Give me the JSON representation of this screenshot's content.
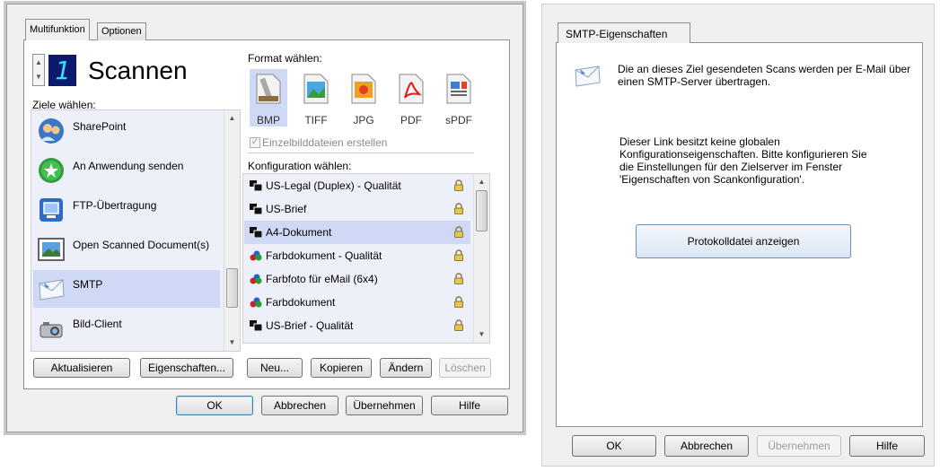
{
  "left_dialog": {
    "tabs": [
      "Multifunktion",
      "Optionen"
    ],
    "mode_number": "1",
    "mode_title": "Scannen",
    "destinations_label": "Ziele wählen:",
    "destinations": [
      {
        "label": "SharePoint",
        "icon": "sharepoint-icon",
        "selected": false
      },
      {
        "label": "An Anwendung senden",
        "icon": "send-to-application-icon",
        "selected": false
      },
      {
        "label": "FTP-Übertragung",
        "icon": "ftp-transfer-icon",
        "selected": false
      },
      {
        "label": "Open Scanned Document(s)",
        "icon": "open-document-icon",
        "selected": false
      },
      {
        "label": "SMTP",
        "icon": "smtp-envelope-icon",
        "selected": true
      },
      {
        "label": "Bild-Client",
        "icon": "image-client-icon",
        "selected": false
      }
    ],
    "format_label": "Format wählen:",
    "formats": [
      {
        "label": "BMP",
        "selected": true
      },
      {
        "label": "TIFF",
        "selected": false
      },
      {
        "label": "JPG",
        "selected": false
      },
      {
        "label": "PDF",
        "selected": false
      },
      {
        "label": "sPDF",
        "selected": false
      }
    ],
    "single_files_checkbox": {
      "label": "Einzelbilddateien erstellen",
      "checked": true,
      "disabled": true
    },
    "config_label": "Konfiguration wählen:",
    "configurations": [
      {
        "label": "US-Legal (Duplex) - Qualität",
        "type": "bw",
        "selected": false
      },
      {
        "label": "US-Brief",
        "type": "bw",
        "selected": false
      },
      {
        "label": "A4-Dokument",
        "type": "bw",
        "selected": true
      },
      {
        "label": "Farbdokument - Qualität",
        "type": "color",
        "selected": false
      },
      {
        "label": "Farbfoto für eMail (6x4)",
        "type": "color",
        "selected": false
      },
      {
        "label": "Farbdokument",
        "type": "color",
        "selected": false
      },
      {
        "label": "US-Brief - Qualität",
        "type": "bw",
        "selected": false
      }
    ],
    "buttons": {
      "refresh": "Aktualisieren",
      "properties": "Eigenschaften...",
      "new": "Neu...",
      "copy": "Kopieren",
      "change": "Ändern",
      "delete": "Löschen",
      "ok": "OK",
      "cancel": "Abbrechen",
      "apply": "Übernehmen",
      "help": "Hilfe"
    }
  },
  "right_dialog": {
    "tab": "SMTP-Eigenschaften",
    "description": "Die an dieses Ziel gesendeten Scans werden per E-Mail über einen SMTP-Server übertragen.",
    "info_lines": [
      "Dieser Link besitzt keine globalen",
      "Konfigurationseigenschaften. Bitte konfigurieren Sie",
      "die Einstellungen für den Zielserver im Fenster",
      "'Eigenschaften von Scankonfiguration'."
    ],
    "show_log_button": "Protokolldatei anzeigen",
    "buttons": {
      "ok": "OK",
      "cancel": "Abbrechen",
      "apply": "Übernehmen",
      "help": "Hilfe"
    }
  },
  "colors": {
    "selection": "#cfd8f5",
    "dialog_bg": "#f0f0f0",
    "border": "#8e8f8f"
  }
}
